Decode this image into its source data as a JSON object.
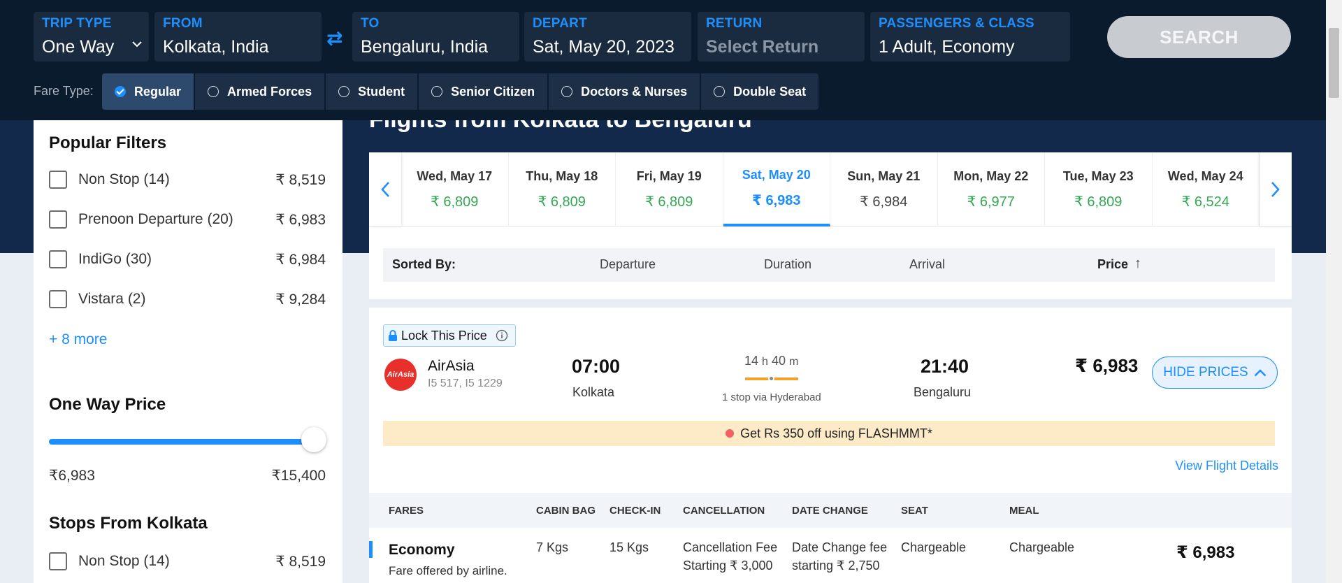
{
  "search": {
    "trip_type": {
      "label": "TRIP TYPE",
      "value": "One Way"
    },
    "from": {
      "label": "FROM",
      "value": "Kolkata, India"
    },
    "to": {
      "label": "TO",
      "value": "Bengaluru, India"
    },
    "depart": {
      "label": "DEPART",
      "value": "Sat, May 20, 2023"
    },
    "return": {
      "label": "RETURN",
      "placeholder": "Select Return"
    },
    "passengers": {
      "label": "PASSENGERS & CLASS",
      "value": "1 Adult, Economy"
    },
    "search_label": "SEARCH",
    "swap_icon": "⇄"
  },
  "fare_type": {
    "label": "Fare Type:",
    "options": [
      "Regular",
      "Armed Forces",
      "Student",
      "Senior Citizen",
      "Doctors & Nurses",
      "Double Seat"
    ],
    "selected": "Regular"
  },
  "page_title": "Flights from Kolkata to Bengaluru",
  "sidebar": {
    "popular_title": "Popular Filters",
    "popular": [
      {
        "label": "Non Stop (14)",
        "price": "₹ 8,519"
      },
      {
        "label": "Prenoon Departure (20)",
        "price": "₹ 6,983"
      },
      {
        "label": "IndiGo (30)",
        "price": "₹ 6,984"
      },
      {
        "label": "Vistara (2)",
        "price": "₹ 9,284"
      }
    ],
    "more": "+ 8 more",
    "price_title": "One Way Price",
    "price_min": "₹6,983",
    "price_max": "₹15,400",
    "price_level": 1.0,
    "stops_title": "Stops From Kolkata",
    "stops": [
      {
        "label": "Non Stop (14)",
        "price": "₹ 8,519"
      }
    ]
  },
  "dates": [
    {
      "day": "Wed, May 17",
      "price": "₹ 6,809",
      "color": "#33a853"
    },
    {
      "day": "Thu, May 18",
      "price": "₹ 6,809",
      "color": "#33a853"
    },
    {
      "day": "Fri, May 19",
      "price": "₹ 6,809",
      "color": "#33a853"
    },
    {
      "day": "Sat, May 20",
      "price": "₹ 6,983",
      "color": "#1d8ffd",
      "active": true
    },
    {
      "day": "Sun, May 21",
      "price": "₹ 6,984",
      "color": "#444444"
    },
    {
      "day": "Mon, May 22",
      "price": "₹ 6,977",
      "color": "#33a853"
    },
    {
      "day": "Tue, May 23",
      "price": "₹ 6,809",
      "color": "#33a853"
    },
    {
      "day": "Wed, May 24",
      "price": "₹ 6,524",
      "color": "#33a853"
    }
  ],
  "sort": {
    "label": "Sorted By:",
    "departure": "Departure",
    "duration": "Duration",
    "arrival": "Arrival",
    "price": "Price",
    "arrow": "↑"
  },
  "flight": {
    "lock_label": "Lock This Price",
    "airline": "AirAsia",
    "logo_text": "AirAsia",
    "codes": "I5 517, I5 1229",
    "depart_time": "07:00",
    "depart_city": "Kolkata",
    "duration_h": "14",
    "duration_h_unit": "h",
    "duration_m": "40",
    "duration_m_unit": "m",
    "stops": "1 stop via Hyderabad",
    "arrive_time": "21:40",
    "arrive_city": "Bengaluru",
    "price": "₹ 6,983",
    "hide_label": "HIDE PRICES",
    "promo": "Get Rs 350 off using FLASHMMT*",
    "view_details": "View Flight Details"
  },
  "fares": {
    "headers": [
      "FARES",
      "CABIN BAG",
      "CHECK-IN",
      "CANCELLATION",
      "DATE CHANGE",
      "SEAT",
      "MEAL"
    ],
    "row": {
      "name": "Economy",
      "sub": "Fare offered by airline.",
      "cabin": "7 Kgs",
      "checkin": "15 Kgs",
      "cancel_1": "Cancellation Fee",
      "cancel_2": "Starting ₹ 3,000",
      "change_1": "Date Change fee",
      "change_2": "starting ₹ 2,750",
      "seat": "Chargeable",
      "meal": "Chargeable",
      "price": "₹ 6,983"
    }
  }
}
